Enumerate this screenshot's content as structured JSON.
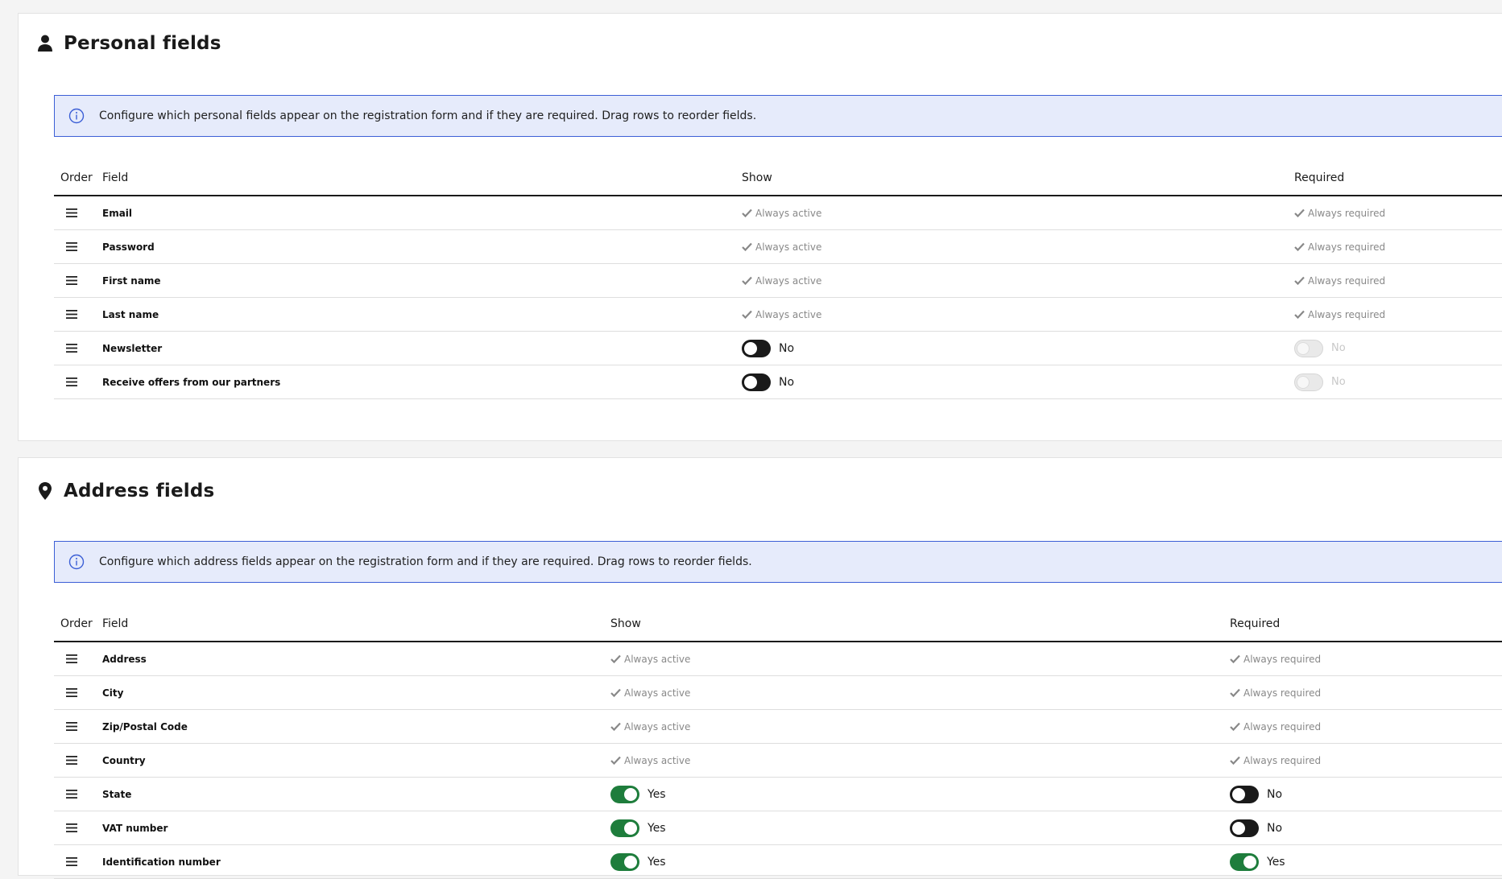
{
  "personal": {
    "title": "Personal fields",
    "icon": "user-icon",
    "notice": "Configure which personal fields appear on the registration form and if they are required. Drag rows to reorder fields.",
    "columns": {
      "order": "Order",
      "field": "Field",
      "show": "Show",
      "required": "Required"
    },
    "rows": [
      {
        "field": "Email",
        "show": "Always active",
        "required": "Always required"
      },
      {
        "field": "Password",
        "show": "Always active",
        "required": "Always required"
      },
      {
        "field": "First name",
        "show": "Always active",
        "required": "Always required"
      },
      {
        "field": "Last name",
        "show": "Always active",
        "required": "Always required"
      },
      {
        "field": "Newsletter",
        "show_toggle": "No",
        "show_state": "off",
        "required_toggle": "No",
        "required_state": "disabled"
      },
      {
        "field": "Receive offers from our partners",
        "show_toggle": "No",
        "show_state": "off",
        "required_toggle": "No",
        "required_state": "disabled"
      }
    ]
  },
  "address": {
    "title": "Address fields",
    "icon": "map-pin-icon",
    "notice": "Configure which address fields appear on the registration form and if they are required. Drag rows to reorder fields.",
    "columns": {
      "order": "Order",
      "field": "Field",
      "show": "Show",
      "required": "Required"
    },
    "rows": [
      {
        "field": "Address",
        "show": "Always active",
        "required": "Always required"
      },
      {
        "field": "City",
        "show": "Always active",
        "required": "Always required"
      },
      {
        "field": "Zip/Postal Code",
        "show": "Always active",
        "required": "Always required"
      },
      {
        "field": "Country",
        "show": "Always active",
        "required": "Always required"
      },
      {
        "field": "State",
        "show_toggle": "Yes",
        "show_state": "on",
        "required_toggle": "No",
        "required_state": "off"
      },
      {
        "field": "VAT number",
        "show_toggle": "Yes",
        "show_state": "on",
        "required_toggle": "No",
        "required_state": "off"
      },
      {
        "field": "Identification number",
        "show_toggle": "Yes",
        "show_state": "on",
        "required_toggle": "Yes",
        "required_state": "on"
      }
    ]
  },
  "colors": {
    "accent_blue": "#3c5fd6",
    "notice_bg": "#e6ebfb",
    "toggle_on": "#1e7d3c",
    "toggle_off": "#1a1a1a",
    "muted_text": "#888888"
  }
}
